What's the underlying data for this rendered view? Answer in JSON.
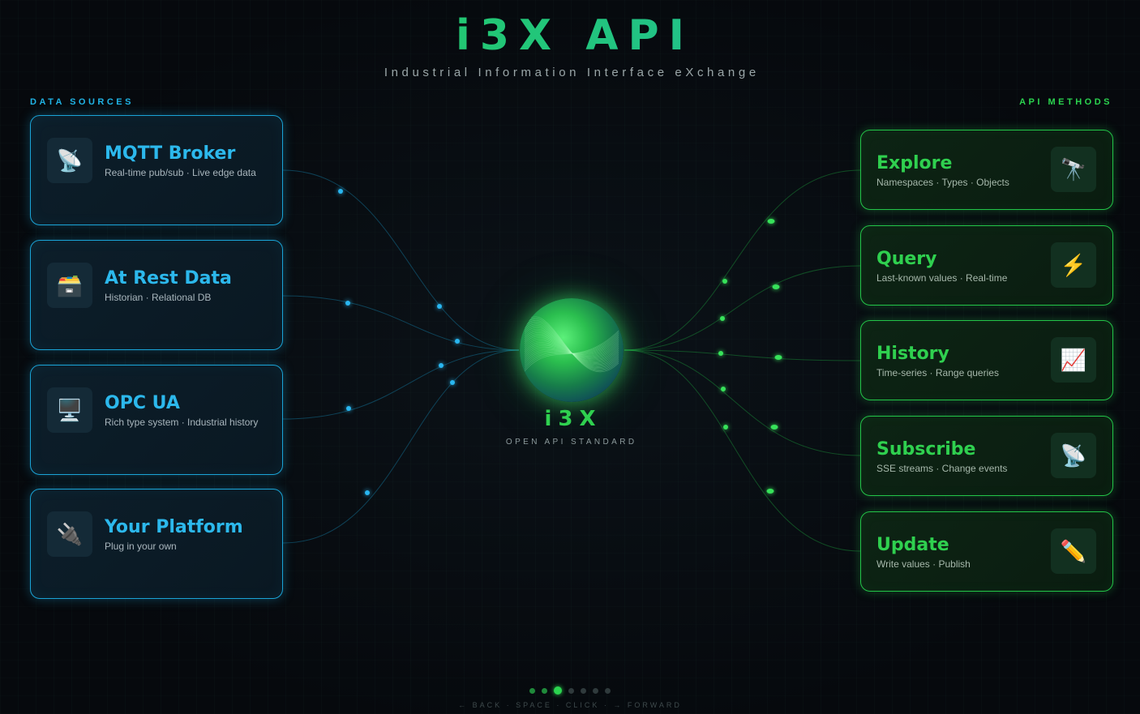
{
  "header": {
    "title": "i3X API",
    "subtitle": "Industrial Information Interface eXchange"
  },
  "sources": {
    "label": "DATA SOURCES",
    "items": [
      {
        "title": "MQTT Broker",
        "subtitle": "Real-time pub/sub · Live edge data",
        "icon": "📡",
        "icon_name": "satellite-dish-icon"
      },
      {
        "title": "At Rest Data",
        "subtitle": "Historian · Relational DB",
        "icon": "🗃️",
        "icon_name": "card-file-box-icon"
      },
      {
        "title": "OPC UA",
        "subtitle": "Rich type system · Industrial history",
        "icon": "🖥️",
        "icon_name": "desktop-computer-icon"
      },
      {
        "title": "Your Platform",
        "subtitle": "Plug in your own",
        "icon": "🔌",
        "icon_name": "electric-plug-icon"
      }
    ]
  },
  "methods": {
    "label": "API METHODS",
    "items": [
      {
        "title": "Explore",
        "subtitle": "Namespaces · Types · Objects",
        "icon": "🔭",
        "icon_name": "telescope-icon"
      },
      {
        "title": "Query",
        "subtitle": "Last-known values · Real-time",
        "icon": "⚡",
        "icon_name": "lightning-icon"
      },
      {
        "title": "History",
        "subtitle": "Time-series · Range queries",
        "icon": "📈",
        "icon_name": "chart-increasing-icon"
      },
      {
        "title": "Subscribe",
        "subtitle": "SSE streams · Change events",
        "icon": "📡",
        "icon_name": "satellite-dish-icon"
      },
      {
        "title": "Update",
        "subtitle": "Write values · Publish",
        "icon": "✏️",
        "icon_name": "pencil-icon"
      }
    ]
  },
  "hub": {
    "label": "i3X",
    "sublabel": "OPEN API STANDARD"
  },
  "navigation": {
    "slide_count": 7,
    "current_slide": 3,
    "hint": "← BACK · SPACE · CLICK · → FORWARD"
  },
  "colors": {
    "source_accent": "#1aa3d6",
    "method_accent": "#23c448",
    "background": "#070b10"
  }
}
